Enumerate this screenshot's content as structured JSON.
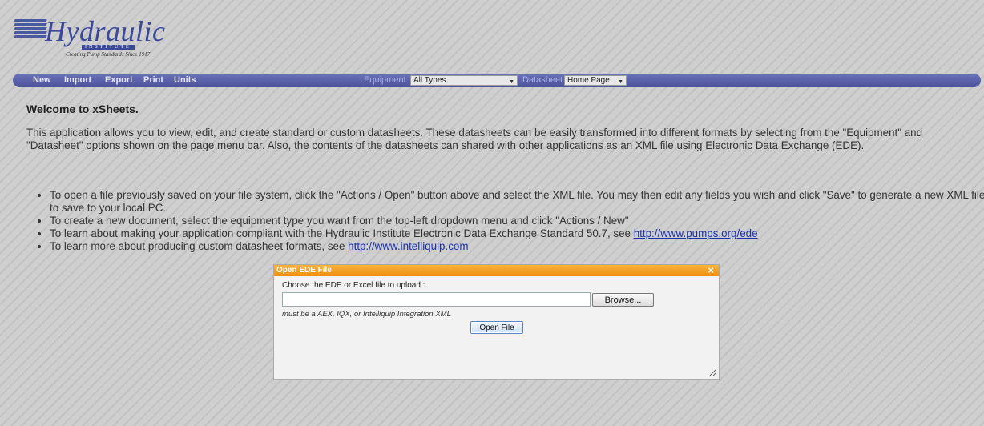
{
  "logo": {
    "word": "Hydraulic",
    "institute": "INSTITUTE",
    "tagline": "Creating Pump Standards Since 1917"
  },
  "menu": {
    "items": [
      "New",
      "Import",
      "Export",
      "Print",
      "Units"
    ],
    "equipment_label": "Equipment:",
    "equipment_value": "All Types",
    "datasheet_label": "Datasheet:",
    "datasheet_value": "Home Page"
  },
  "content": {
    "welcome": "Welcome to xSheets.",
    "intro": "This application allows you to view, edit, and create standard or custom datasheets. These datasheets can be easily transformed into different formats by selecting from the \"Equipment\" and \"Datasheet\" options shown on the page menu bar. Also, the contents of the datasheets can shared with other applications as an XML file using Electronic Data Exchange (EDE).",
    "bullets": [
      {
        "text": "To open a file previously saved on your file system, click the \"Actions / Open\" button above and select the XML file. You may then edit any fields you wish and click \"Save\" to generate a new XML file to save to your local PC.",
        "link": ""
      },
      {
        "text": "To create a new document, select the equipment type you want from the top-left dropdown menu and click \"Actions / New\"",
        "link": ""
      },
      {
        "text": "To learn about making your application compliant with the Hydraulic Institute Electronic Data Exchange Standard 50.7, see ",
        "link": "http://www.pumps.org/ede"
      },
      {
        "text": "To learn more about producing custom datasheet formats, see ",
        "link": "http://www.intelliquip.com"
      }
    ]
  },
  "dialog": {
    "title": "Open EDE File",
    "close": "×",
    "prompt": "Choose the EDE or Excel file to upload :",
    "file_value": "",
    "browse_label": "Browse...",
    "hint": "must be a AEX, IQX, or Intelliquip Integration XML",
    "open_label": "Open File"
  },
  "colors": {
    "menubar": "#5a62aa",
    "dialog_titlebar": "#f2a024",
    "link": "#1a33aa"
  }
}
